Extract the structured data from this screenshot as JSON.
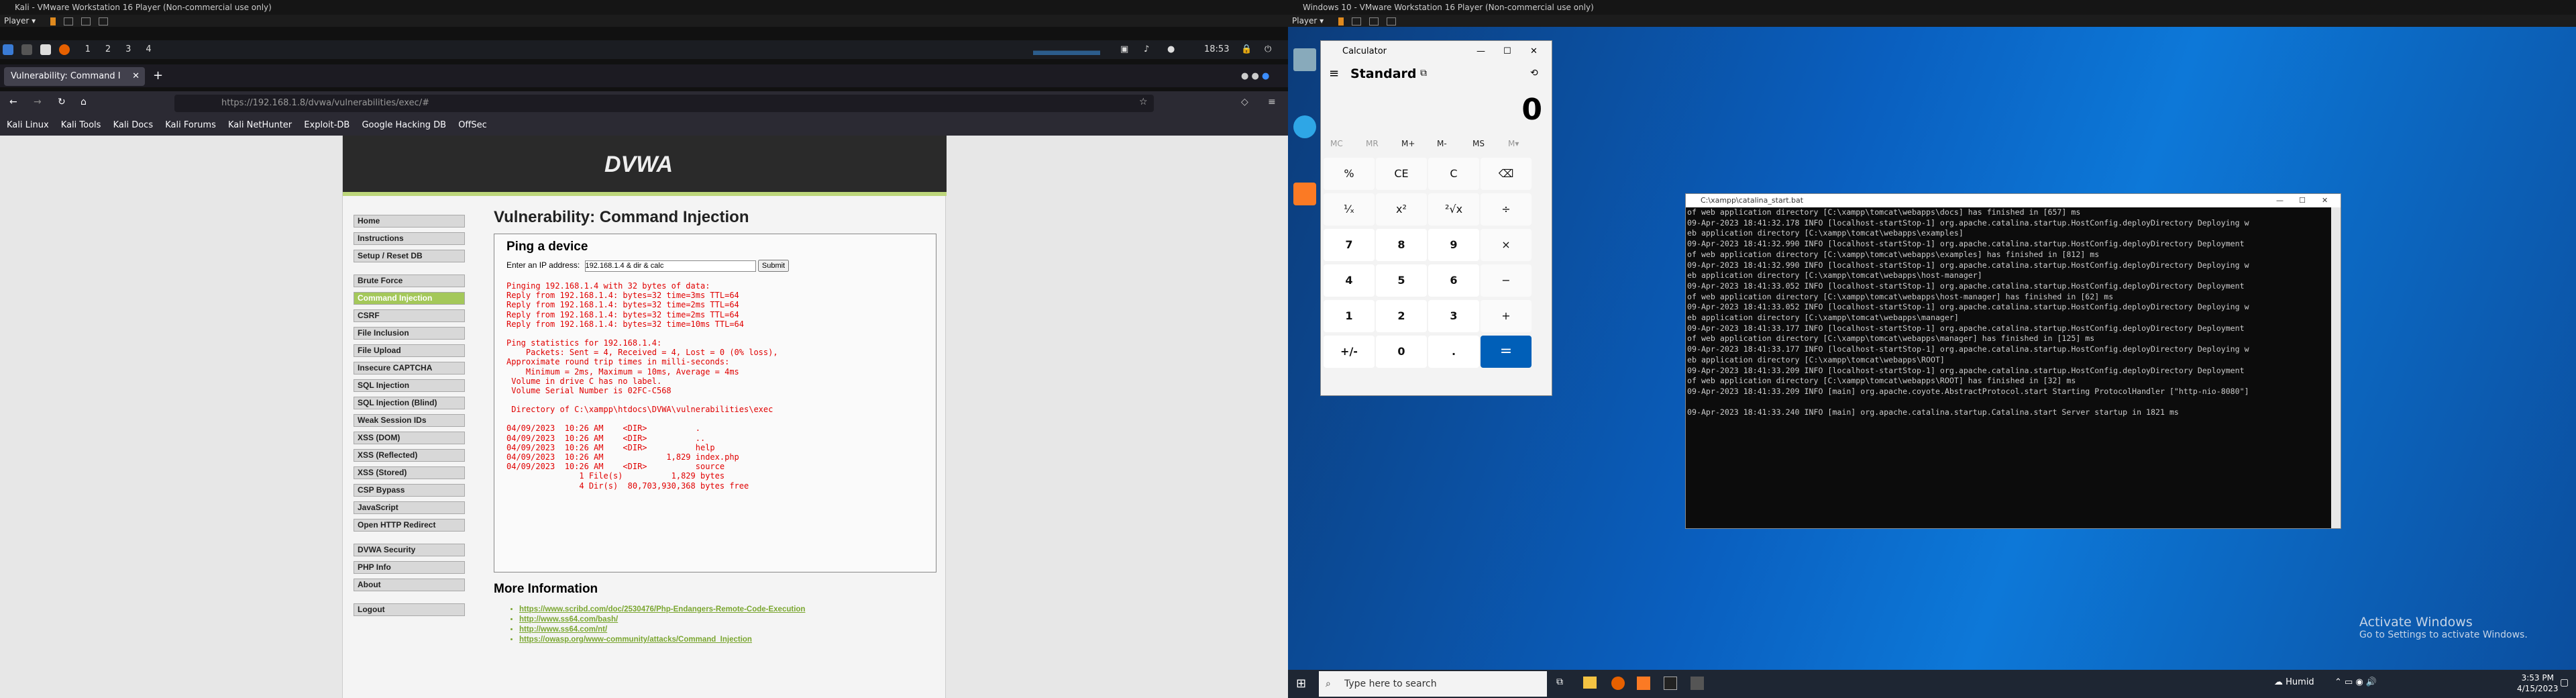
{
  "left_host": {
    "title": "Kali - VMware Workstation 16 Player (Non-commercial use only)",
    "player_label": "Player ▾"
  },
  "right_host": {
    "title": "Windows 10 - VMware Workstation 16 Player (Non-commercial use only)",
    "player_label": "Player ▾"
  },
  "kali_panel": {
    "workspaces": [
      "1",
      "2",
      "3",
      "4"
    ],
    "clock": "18:53"
  },
  "firefox": {
    "tab_title": "Vulnerability: Command I",
    "url": "https://192.168.1.8/dvwa/vulnerabilities/exec/#",
    "bookmarks": [
      "Kali Linux",
      "Kali Tools",
      "Kali Docs",
      "Kali Forums",
      "Kali NetHunter",
      "Exploit-DB",
      "Google Hacking DB",
      "OffSec"
    ]
  },
  "dvwa": {
    "logo": "DVWA",
    "menu_group1": [
      "Home",
      "Instructions",
      "Setup / Reset DB"
    ],
    "menu_group2": [
      "Brute Force",
      "Command Injection",
      "CSRF",
      "File Inclusion",
      "File Upload",
      "Insecure CAPTCHA",
      "SQL Injection",
      "SQL Injection (Blind)",
      "Weak Session IDs",
      "XSS (DOM)",
      "XSS (Reflected)",
      "XSS (Stored)",
      "CSP Bypass",
      "JavaScript",
      "Open HTTP Redirect"
    ],
    "menu_group3": [
      "DVWA Security",
      "PHP Info",
      "About"
    ],
    "menu_group4": [
      "Logout"
    ],
    "heading": "Vulnerability: Command Injection",
    "box_title": "Ping a device",
    "ip_label": "Enter an IP address:",
    "ip_value": "192.168.1.4 & dir & calc",
    "submit_label": "Submit",
    "output_lines": [
      "Pinging 192.168.1.4 with 32 bytes of data:",
      "Reply from 192.168.1.4: bytes=32 time=3ms TTL=64",
      "Reply from 192.168.1.4: bytes=32 time=2ms TTL=64",
      "Reply from 192.168.1.4: bytes=32 time=2ms TTL=64",
      "Reply from 192.168.1.4: bytes=32 time=10ms TTL=64",
      "",
      "Ping statistics for 192.168.1.4:",
      "    Packets: Sent = 4, Received = 4, Lost = 0 (0% loss),",
      "Approximate round trip times in milli-seconds:",
      "    Minimum = 2ms, Maximum = 10ms, Average = 4ms",
      " Volume in drive C has no label.",
      " Volume Serial Number is 02FC-C568",
      "",
      " Directory of C:\\xampp\\htdocs\\DVWA\\vulnerabilities\\exec",
      "",
      "04/09/2023  10:26 AM    <DIR>          .",
      "04/09/2023  10:26 AM    <DIR>          ..",
      "04/09/2023  10:26 AM    <DIR>          help",
      "04/09/2023  10:26 AM             1,829 index.php",
      "04/09/2023  10:26 AM    <DIR>          source",
      "               1 File(s)          1,829 bytes",
      "               4 Dir(s)  80,703,930,368 bytes free"
    ],
    "more_info_title": "More Information",
    "links": [
      "https://www.scribd.com/doc/2530476/Php-Endangers-Remote-Code-Execution",
      "http://www.ss64.com/bash/",
      "http://www.ss64.com/nt/",
      "https://owasp.org/www-community/attacks/Command_Injection"
    ]
  },
  "calculator": {
    "title": "Calculator",
    "mode": "Standard",
    "display": "0",
    "memory": [
      "MC",
      "MR",
      "M+",
      "M-",
      "MS",
      "M▾"
    ],
    "buttons": [
      [
        "%",
        "CE",
        "C",
        "⌫"
      ],
      [
        "¹⁄ₓ",
        "x²",
        "²√x",
        "÷"
      ],
      [
        "7",
        "8",
        "9",
        "×"
      ],
      [
        "4",
        "5",
        "6",
        "−"
      ],
      [
        "1",
        "2",
        "3",
        "+"
      ],
      [
        "+/-",
        "0",
        ".",
        "="
      ]
    ]
  },
  "console": {
    "title": "C:\\xampp\\catalina_start.bat",
    "lines": [
      "of web application directory [C:\\xampp\\tomcat\\webapps\\docs] has finished in [657] ms",
      "09-Apr-2023 18:41:32.178 INFO [localhost-startStop-1] org.apache.catalina.startup.HostConfig.deployDirectory Deploying w",
      "eb application directory [C:\\xampp\\tomcat\\webapps\\examples]",
      "09-Apr-2023 18:41:32.990 INFO [localhost-startStop-1] org.apache.catalina.startup.HostConfig.deployDirectory Deployment",
      "of web application directory [C:\\xampp\\tomcat\\webapps\\examples] has finished in [812] ms",
      "09-Apr-2023 18:41:32.990 INFO [localhost-startStop-1] org.apache.catalina.startup.HostConfig.deployDirectory Deploying w",
      "eb application directory [C:\\xampp\\tomcat\\webapps\\host-manager]",
      "09-Apr-2023 18:41:33.052 INFO [localhost-startStop-1] org.apache.catalina.startup.HostConfig.deployDirectory Deployment",
      "of web application directory [C:\\xampp\\tomcat\\webapps\\host-manager] has finished in [62] ms",
      "09-Apr-2023 18:41:33.052 INFO [localhost-startStop-1] org.apache.catalina.startup.HostConfig.deployDirectory Deploying w",
      "eb application directory [C:\\xampp\\tomcat\\webapps\\manager]",
      "09-Apr-2023 18:41:33.177 INFO [localhost-startStop-1] org.apache.catalina.startup.HostConfig.deployDirectory Deployment",
      "of web application directory [C:\\xampp\\tomcat\\webapps\\manager] has finished in [125] ms",
      "09-Apr-2023 18:41:33.177 INFO [localhost-startStop-1] org.apache.catalina.startup.HostConfig.deployDirectory Deploying w",
      "eb application directory [C:\\xampp\\tomcat\\webapps\\ROOT]",
      "09-Apr-2023 18:41:33.209 INFO [localhost-startStop-1] org.apache.catalina.startup.HostConfig.deployDirectory Deployment",
      "of web application directory [C:\\xampp\\tomcat\\webapps\\ROOT] has finished in [32] ms",
      "09-Apr-2023 18:41:33.209 INFO [main] org.apache.coyote.AbstractProtocol.start Starting ProtocolHandler [\"http-nio-8080\"]",
      "",
      "09-Apr-2023 18:41:33.240 INFO [main] org.apache.catalina.startup.Catalina.start Server startup in 1821 ms"
    ]
  },
  "windows": {
    "activate_title": "Activate Windows",
    "activate_sub": "Go to Settings to activate Windows.",
    "search_placeholder": "Type here to search",
    "weather": "Humid",
    "time": "3:53 PM",
    "date": "4/15/2023"
  }
}
